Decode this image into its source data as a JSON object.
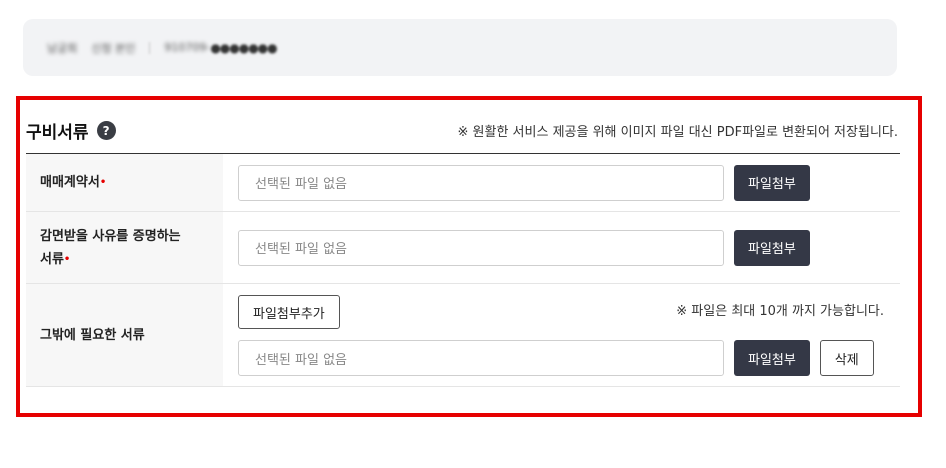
{
  "applicant": {
    "name": "남궁희",
    "relation": "신청 본인",
    "id_prefix": "910709-",
    "id_masked": "●●●●●●●"
  },
  "section": {
    "title": "구비서류",
    "help_icon_glyph": "?",
    "notice": "※ 원활한 서비스 제공을 위해 이미지 파일 대신 PDF파일로 변환되어 저장됩니다."
  },
  "rows": [
    {
      "label": "매매계약서",
      "required_mark": "•",
      "file_placeholder": "선택된 파일 없음",
      "attach_label": "파일첨부"
    },
    {
      "label_line1": "감면받을 사유를 증명하는",
      "label_line2": "서류",
      "required_mark": "•",
      "file_placeholder": "선택된 파일 없음",
      "attach_label": "파일첨부"
    },
    {
      "label": "그밖에 필요한 서류",
      "add_label": "파일첨부추가",
      "limit_note": "※ 파일은 최대 10개 까지 가능합니다.",
      "file_placeholder": "선택된 파일 없음",
      "attach_label": "파일첨부",
      "delete_label": "삭제"
    }
  ],
  "colors": {
    "highlight": "#e60000",
    "dark_button": "#343846",
    "required": "#e60000"
  }
}
